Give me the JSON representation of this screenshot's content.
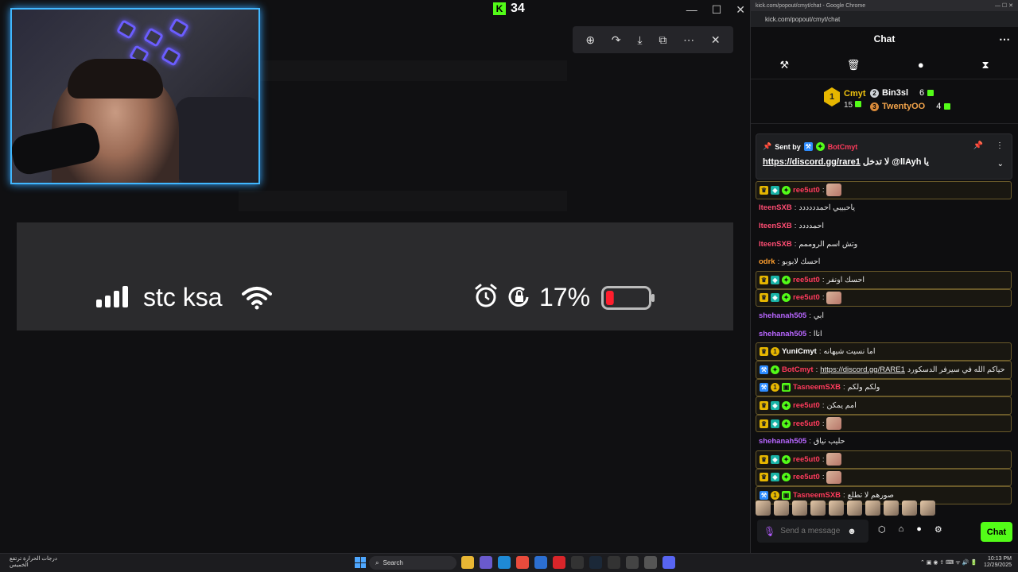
{
  "stream": {
    "viewer_count": "34",
    "viewer_logo": "K"
  },
  "phone_status": {
    "carrier": "stc ksa",
    "battery_percent": "17%",
    "battery_level": 0.17,
    "signal_bars": 4
  },
  "chrome": {
    "title": "kick.com/popout/cmyt/chat - Google Chrome",
    "url": "kick.com/popout/cmyt/chat"
  },
  "chat": {
    "header_title": "Chat",
    "leaderboard": {
      "first": {
        "name": "Cmyt",
        "rank": "1",
        "count": "15"
      },
      "second": {
        "name": "Bin3sl",
        "count": "6"
      },
      "third": {
        "name": "TwentyOO",
        "count": "4"
      }
    },
    "pinned": {
      "sent_by_label": "Sent by",
      "sender": "BotCmyt",
      "link": "https://discord.gg/rare1",
      "text": "لا تدخل @llAyh يا"
    },
    "messages": [
      {
        "user": "ree5ut0",
        "text": "",
        "color": "#ff3b5c",
        "highlight": true,
        "badges": [
          "crown",
          "vip",
          "star"
        ],
        "emote": true
      },
      {
        "user": "lteenSXB",
        "text": "ياحبيبي احمدددددد",
        "color": "#ff4d73",
        "highlight": false,
        "badges": []
      },
      {
        "user": "lteenSXB",
        "text": "احمدددد",
        "color": "#ff4d73",
        "highlight": false,
        "badges": []
      },
      {
        "user": "lteenSXB",
        "text": "وتش اسم الروممم",
        "color": "#ff4d73",
        "highlight": false,
        "badges": []
      },
      {
        "user": "odrk",
        "text": "احسك لابوبو",
        "color": "#ff9f2e",
        "highlight": false,
        "badges": []
      },
      {
        "user": "ree5ut0",
        "text": "احسك اونفر",
        "color": "#ff3b5c",
        "highlight": true,
        "badges": [
          "crown",
          "vip",
          "star"
        ]
      },
      {
        "user": "ree5ut0",
        "text": "",
        "color": "#ff3b5c",
        "highlight": true,
        "badges": [
          "crown",
          "vip",
          "star"
        ],
        "emote": true
      },
      {
        "user": "shehanah505",
        "text": "ابي",
        "color": "#b866ff",
        "highlight": false,
        "badges": []
      },
      {
        "user": "shehanah505",
        "text": "اناا",
        "color": "#b866ff",
        "highlight": false,
        "badges": []
      },
      {
        "user": "YuniCmyt",
        "text": "اما نسيت شيهانه",
        "color": "#ffffff",
        "highlight": true,
        "badges": [
          "crown",
          "one"
        ]
      },
      {
        "user": "BotCmyt",
        "text": "حياكم الله في سيرفر الدسكورد",
        "link": "https://discord.gg/RARE1",
        "color": "#ff3b5c",
        "highlight": true,
        "badges": [
          "mod",
          "star"
        ]
      },
      {
        "user": "TasneemSXB",
        "text": "ولكم ولكم",
        "color": "#ff3b5c",
        "highlight": true,
        "badges": [
          "mod",
          "one",
          "gift"
        ]
      },
      {
        "user": "ree5ut0",
        "text": "امم يمكن",
        "color": "#ff3b5c",
        "highlight": true,
        "badges": [
          "crown",
          "vip",
          "star"
        ]
      },
      {
        "user": "ree5ut0",
        "text": "",
        "color": "#ff3b5c",
        "highlight": true,
        "badges": [
          "crown",
          "vip",
          "star"
        ],
        "emote": true
      },
      {
        "user": "shehanah505",
        "text": "حليب نياق",
        "color": "#b866ff",
        "highlight": false,
        "badges": []
      },
      {
        "user": "ree5ut0",
        "text": "",
        "color": "#ff3b5c",
        "highlight": true,
        "badges": [
          "crown",
          "vip",
          "star"
        ],
        "emote": true
      },
      {
        "user": "ree5ut0",
        "text": "",
        "color": "#ff3b5c",
        "highlight": true,
        "badges": [
          "crown",
          "vip",
          "star"
        ],
        "emote": true
      },
      {
        "user": "TasneemSXB",
        "text": "صورهم لا تطلع",
        "color": "#ff3b5c",
        "highlight": true,
        "badges": [
          "mod",
          "one",
          "gift"
        ]
      }
    ],
    "input_placeholder": "Send a message",
    "send_label": "Chat"
  },
  "taskbar": {
    "weather_line1": "درجات الحرارة ترتفع",
    "weather_line2": "الخميس",
    "search_label": "Search",
    "time": "10:13 PM",
    "date": "12/29/2025"
  },
  "colors": {
    "kick_green": "#53fc18",
    "camera_border": "#41b7ff",
    "gold": "#e6b600"
  }
}
